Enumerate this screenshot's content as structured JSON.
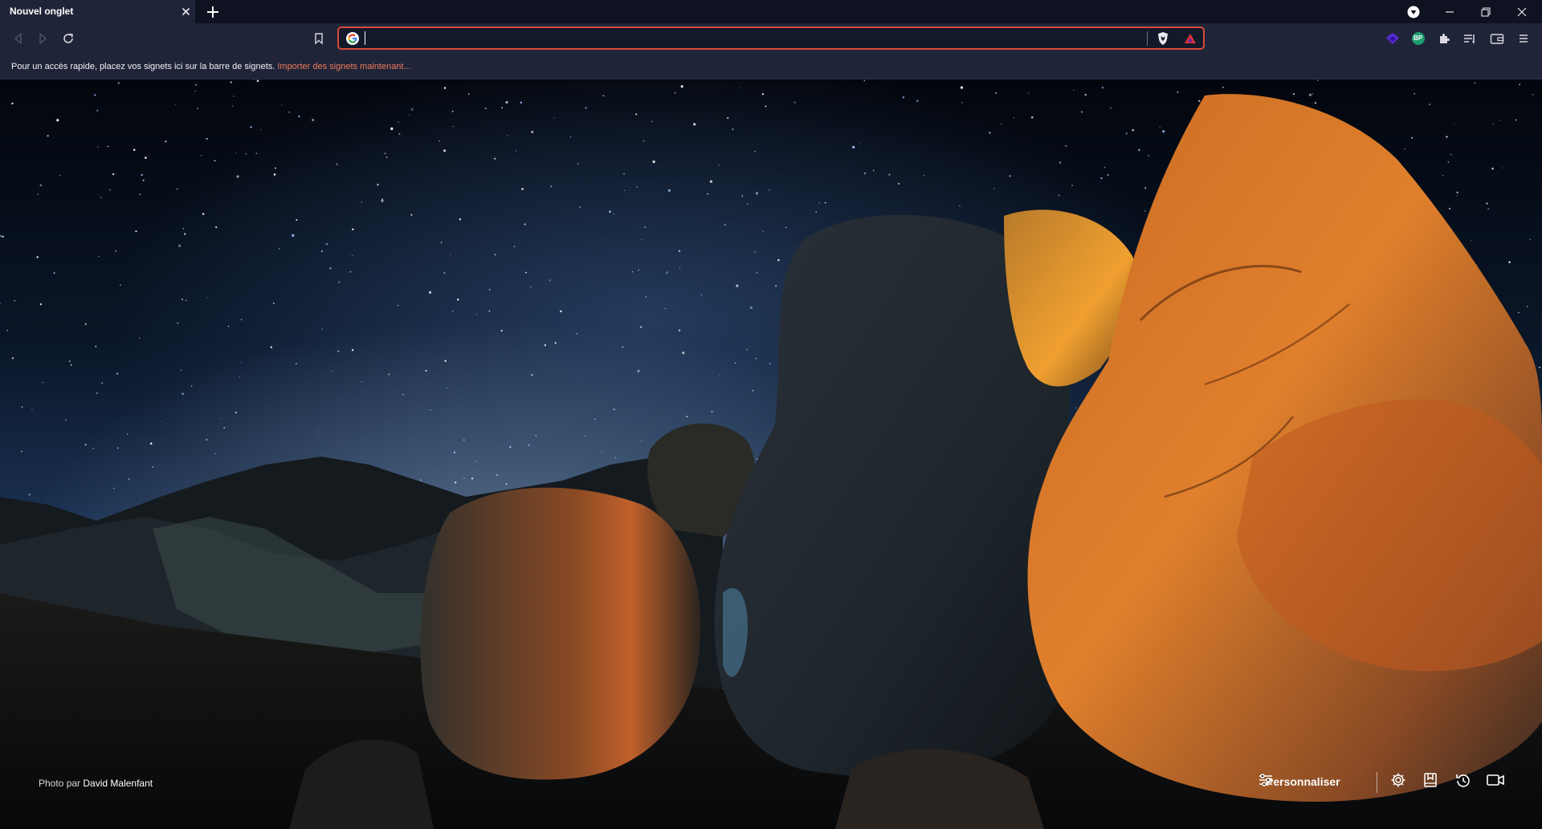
{
  "tab": {
    "title": "Nouvel onglet"
  },
  "address_bar": {
    "value": "",
    "search_engine_icon": "google-g-icon"
  },
  "bookmarks_bar": {
    "message": "Pour un accès rapide, placez vos signets ici sur la barre de signets.",
    "import_link": "Importer des signets maintenant..."
  },
  "extensions": {
    "profile_badge": "BP"
  },
  "new_tab_page": {
    "photo_credit_prefix": "Photo par",
    "photo_credit_author": "David Malenfant",
    "customize_label": "Personnaliser"
  },
  "colors": {
    "accent": "#d94a3a",
    "link": "#f07a5a",
    "toolbar": "#1f2438",
    "tabstrip": "#0f1220"
  },
  "icons": [
    "close-icon",
    "plus-icon",
    "vpn-shield-icon",
    "minimize-icon",
    "restore-icon",
    "back-icon",
    "forward-icon",
    "reload-icon",
    "bookmark-icon",
    "brave-shield-icon",
    "brave-rewards-icon",
    "extension-puzzle-icon",
    "reading-list-icon",
    "wallet-icon",
    "menu-icon",
    "sliders-icon",
    "gear-icon",
    "bookmarks-page-icon",
    "history-icon",
    "video-camera-icon"
  ]
}
